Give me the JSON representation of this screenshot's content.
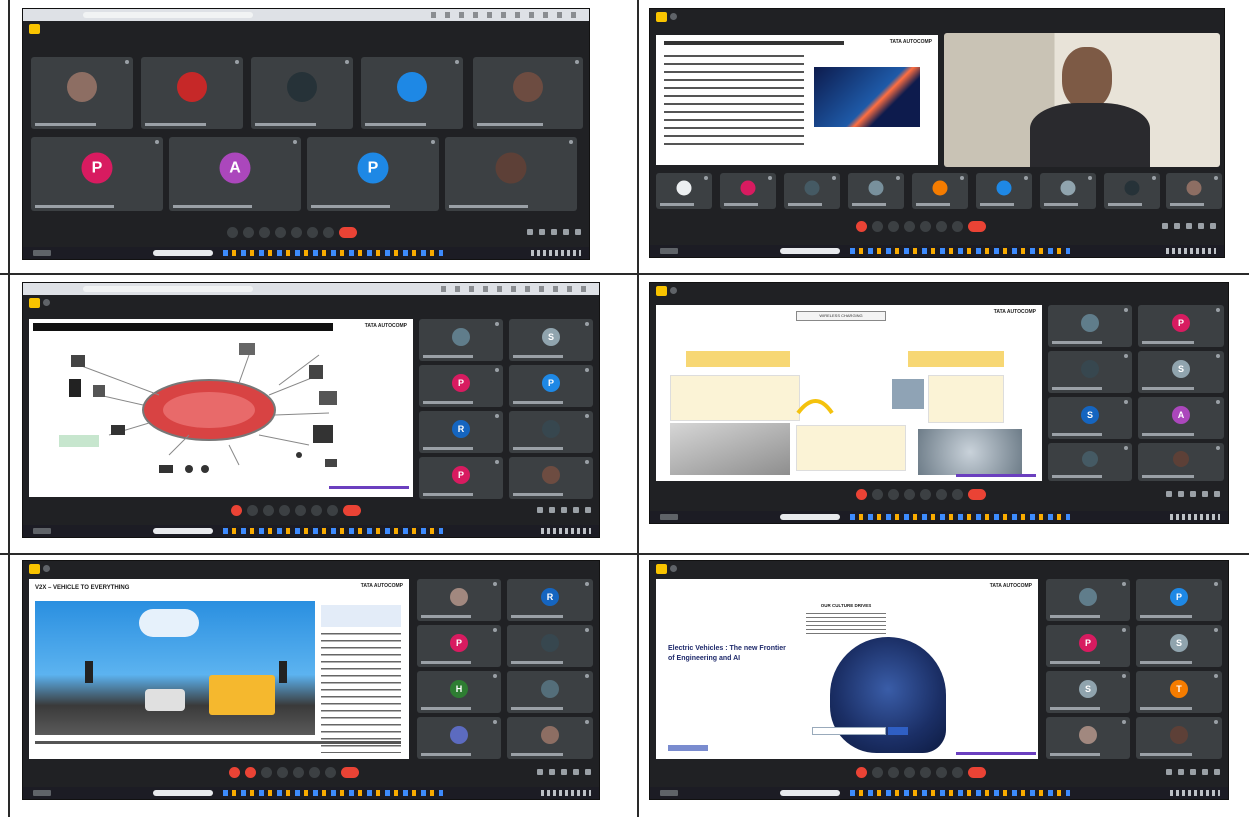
{
  "screens": [
    {
      "id": "s1",
      "participants": [
        {
          "initial": "",
          "color": "#8d6e63"
        },
        {
          "initial": "",
          "color": "#c62828"
        },
        {
          "initial": "",
          "color": "#263238"
        },
        {
          "initial": "",
          "color": "#1e88e5"
        },
        {
          "initial": "",
          "color": "#6d4c41"
        },
        {
          "initial": "P",
          "color": "#d81b60"
        },
        {
          "initial": "A",
          "color": "#ab47bc"
        },
        {
          "initial": "P",
          "color": "#1e88e5"
        },
        {
          "initial": "",
          "color": "#5d4037"
        }
      ]
    },
    {
      "id": "s2",
      "participants": [
        {
          "initial": "",
          "color": "#eceff1"
        },
        {
          "initial": "",
          "color": "#d81b60"
        },
        {
          "initial": "",
          "color": "#455a64"
        },
        {
          "initial": "",
          "color": "#78909c"
        },
        {
          "initial": "",
          "color": "#f57c00"
        },
        {
          "initial": "",
          "color": "#1e88e5"
        },
        {
          "initial": "",
          "color": "#90a4ae"
        },
        {
          "initial": "",
          "color": "#263238"
        },
        {
          "initial": "",
          "color": "#8d6e63"
        }
      ]
    },
    {
      "id": "s3",
      "participants": [
        {
          "initial": "",
          "color": "#607d8b"
        },
        {
          "initial": "S",
          "color": "#90a4ae"
        },
        {
          "initial": "P",
          "color": "#d81b60"
        },
        {
          "initial": "P",
          "color": "#1e88e5"
        },
        {
          "initial": "R",
          "color": "#1565c0"
        },
        {
          "initial": "",
          "color": "#37474f"
        },
        {
          "initial": "P",
          "color": "#d81b60"
        },
        {
          "initial": "",
          "color": "#6d4c41"
        }
      ]
    },
    {
      "id": "s4",
      "participants": [
        {
          "initial": "",
          "color": "#607d8b"
        },
        {
          "initial": "P",
          "color": "#d81b60"
        },
        {
          "initial": "",
          "color": "#37474f"
        },
        {
          "initial": "S",
          "color": "#90a4ae"
        },
        {
          "initial": "S",
          "color": "#1565c0"
        },
        {
          "initial": "A",
          "color": "#ab47bc"
        },
        {
          "initial": "",
          "color": "#455a64"
        },
        {
          "initial": "",
          "color": "#5d4037"
        }
      ]
    },
    {
      "id": "s5",
      "participants": [
        {
          "initial": "",
          "color": "#a1887f"
        },
        {
          "initial": "R",
          "color": "#1565c0"
        },
        {
          "initial": "P",
          "color": "#d81b60"
        },
        {
          "initial": "",
          "color": "#37474f"
        },
        {
          "initial": "H",
          "color": "#2e7d32"
        },
        {
          "initial": "",
          "color": "#546e7a"
        },
        {
          "initial": "",
          "color": "#5c6bc0"
        },
        {
          "initial": "",
          "color": "#8d6e63"
        }
      ]
    },
    {
      "id": "s6",
      "participants": [
        {
          "initial": "",
          "color": "#607d8b"
        },
        {
          "initial": "P",
          "color": "#1e88e5"
        },
        {
          "initial": "P",
          "color": "#d81b60"
        },
        {
          "initial": "S",
          "color": "#90a4ae"
        },
        {
          "initial": "S",
          "color": "#90a4ae"
        },
        {
          "initial": "T",
          "color": "#f57c00"
        },
        {
          "initial": "",
          "color": "#a1887f"
        },
        {
          "initial": "",
          "color": "#5d4037"
        }
      ]
    }
  ],
  "slides": {
    "s5_title": "V2X – VEHICLE TO EVERYTHING",
    "s6_title_line1": "Electric Vehicles : The new Frontier",
    "s6_title_line2": "of Engineering and AI",
    "s6_heading": "OUR CULTURE DRIVES",
    "s4_heading": "WIRELESS CHARGING"
  }
}
